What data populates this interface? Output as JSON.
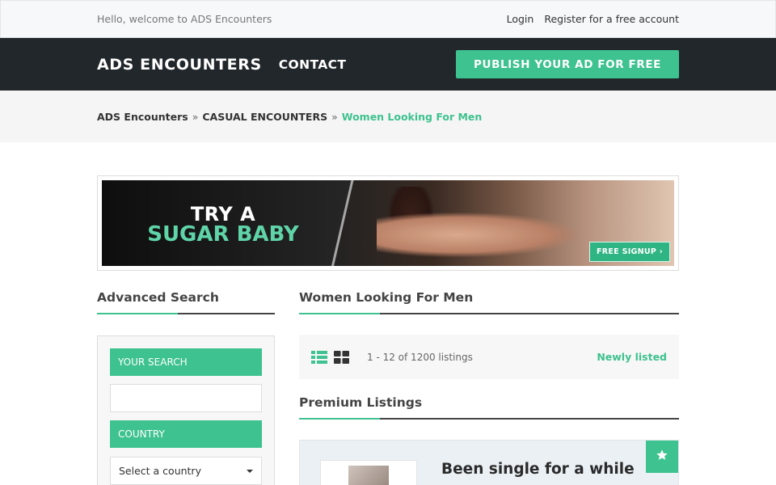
{
  "topbar": {
    "welcome": "Hello, welcome to ADS Encounters",
    "login": "Login",
    "register": "Register for a free account"
  },
  "header": {
    "logo": "ADS ENCOUNTERS",
    "contact": "CONTACT",
    "publish": "PUBLISH YOUR AD FOR FREE"
  },
  "breadcrumb": {
    "items": [
      "ADS Encounters",
      "CASUAL ENCOUNTERS",
      "Women Looking For Men"
    ],
    "separator": "»"
  },
  "banner": {
    "line1": "TRY A",
    "line2": "SUGAR BABY",
    "cta": "FREE SIGNUP ›"
  },
  "sidebar": {
    "title": "Advanced Search",
    "search_label": "YOUR SEARCH",
    "search_value": "",
    "country_label": "COUNTRY",
    "country_selected": "Select a country"
  },
  "main": {
    "title": "Women Looking For Men",
    "listing_count": "1 - 12 of 1200 listings",
    "sort": "Newly listed",
    "premium_title": "Premium Listings",
    "card_title": "Been single for a while"
  },
  "colors": {
    "accent": "#3ec28f",
    "header_bg": "#22272b",
    "topbar_bg": "#f7f8fa"
  },
  "icons": [
    "list-view-icon",
    "grid-view-icon",
    "star-icon",
    "chevron-down-icon"
  ]
}
